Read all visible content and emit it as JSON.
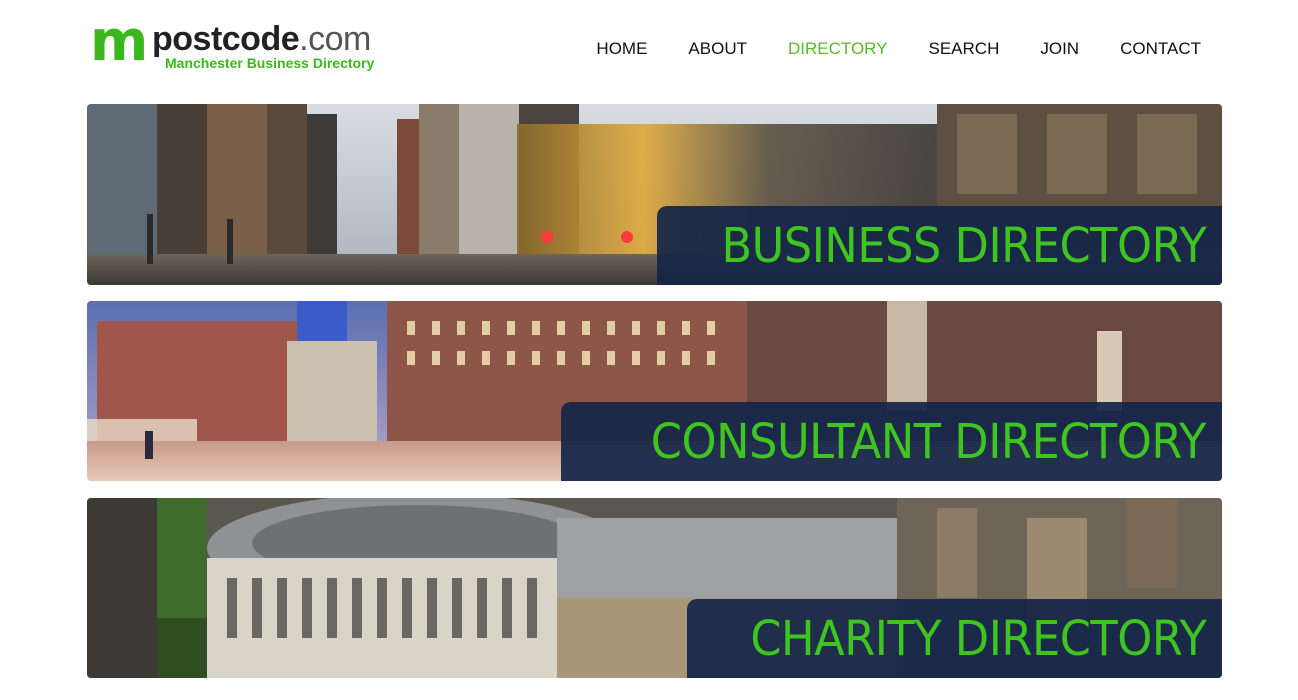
{
  "brand": {
    "logo_m": "m",
    "logo_name": "postcode",
    "logo_suffix": ".com",
    "tagline": "Manchester Business Directory"
  },
  "nav": {
    "items": [
      {
        "label": "HOME"
      },
      {
        "label": "ABOUT"
      },
      {
        "label": "DIRECTORY",
        "active": true
      },
      {
        "label": "SEARCH"
      },
      {
        "label": "JOIN"
      },
      {
        "label": "CONTACT"
      }
    ]
  },
  "banners": [
    {
      "label": "BUSINESS DIRECTORY"
    },
    {
      "label": "CONSULTANT DIRECTORY"
    },
    {
      "label": "CHARITY DIRECTORY"
    }
  ],
  "colors": {
    "brand_green": "#3ab81b",
    "nav_active": "#5bb82f",
    "label_bg": "#162648",
    "label_text": "#3ec51f"
  }
}
